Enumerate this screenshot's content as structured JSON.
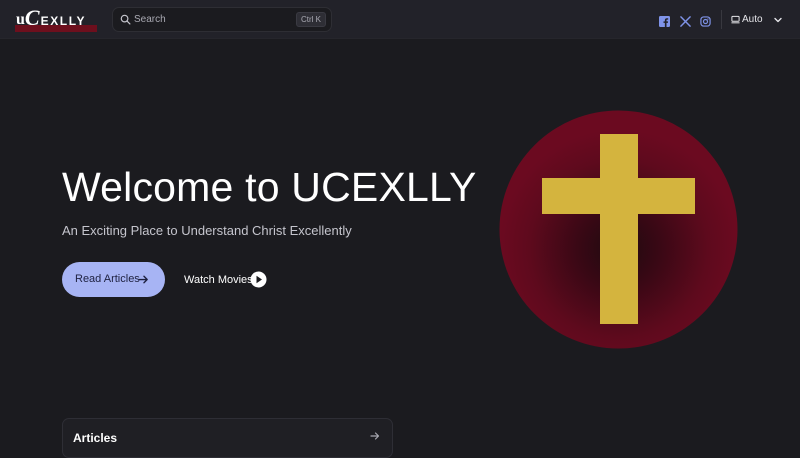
{
  "brand": {
    "logo_u": "u",
    "logo_c": "C",
    "logo_rest": "EXLLY",
    "accent": "#6d0f1d"
  },
  "search": {
    "label": "Search",
    "shortcut": "Ctrl K",
    "icon": "search-icon"
  },
  "social": [
    {
      "name": "facebook",
      "icon": "facebook-icon"
    },
    {
      "name": "x",
      "icon": "x-icon"
    },
    {
      "name": "instagram",
      "icon": "instagram-icon"
    }
  ],
  "theme": {
    "label": "Auto",
    "icon": "monitor-icon"
  },
  "hero": {
    "title": "Welcome to UCEXLLY",
    "subtitle": "An Exciting Place to Understand Christ Excellently",
    "primary_button": "Read Articles",
    "secondary_button": "Watch Movies",
    "primary_color": "#a7b4f4",
    "graphic": "cross-icon",
    "graphic_colors": {
      "circle": "#6b0a20",
      "cross": "#d4b43e"
    }
  },
  "cards": [
    {
      "title": "Articles"
    }
  ]
}
